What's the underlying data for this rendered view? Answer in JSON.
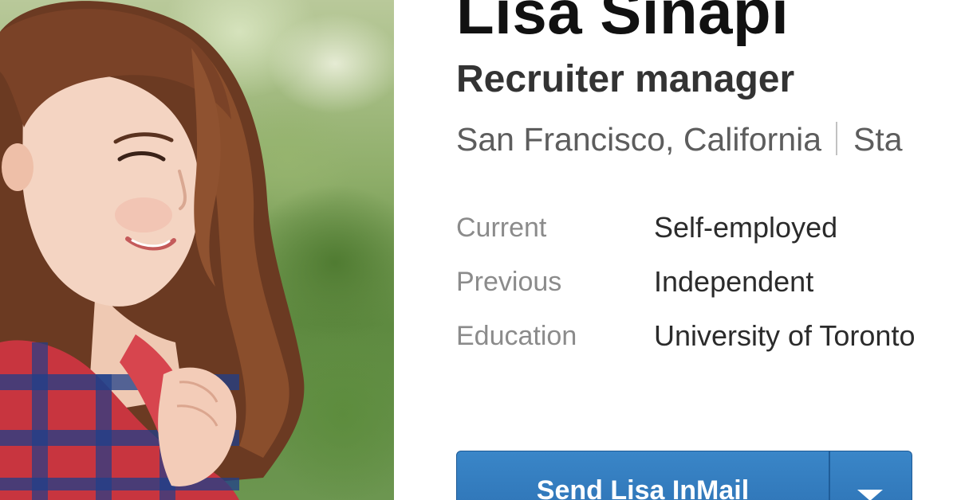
{
  "profile": {
    "name": "Lisa Sinapi",
    "headline": "Recruiter manager",
    "location": "San Francisco, California",
    "industry_partial": "Sta",
    "details": [
      {
        "label": "Current",
        "value": "Self-employed"
      },
      {
        "label": "Previous",
        "value": "Independent"
      },
      {
        "label": "Education",
        "value": "University of Toronto"
      }
    ]
  },
  "actions": {
    "inmail_label": "Send Lisa InMail",
    "dropdown_icon": "caret-down-icon"
  },
  "colors": {
    "button_blue": "#2d72b4",
    "name_text": "#111111",
    "label_gray": "#8b8b8b"
  }
}
